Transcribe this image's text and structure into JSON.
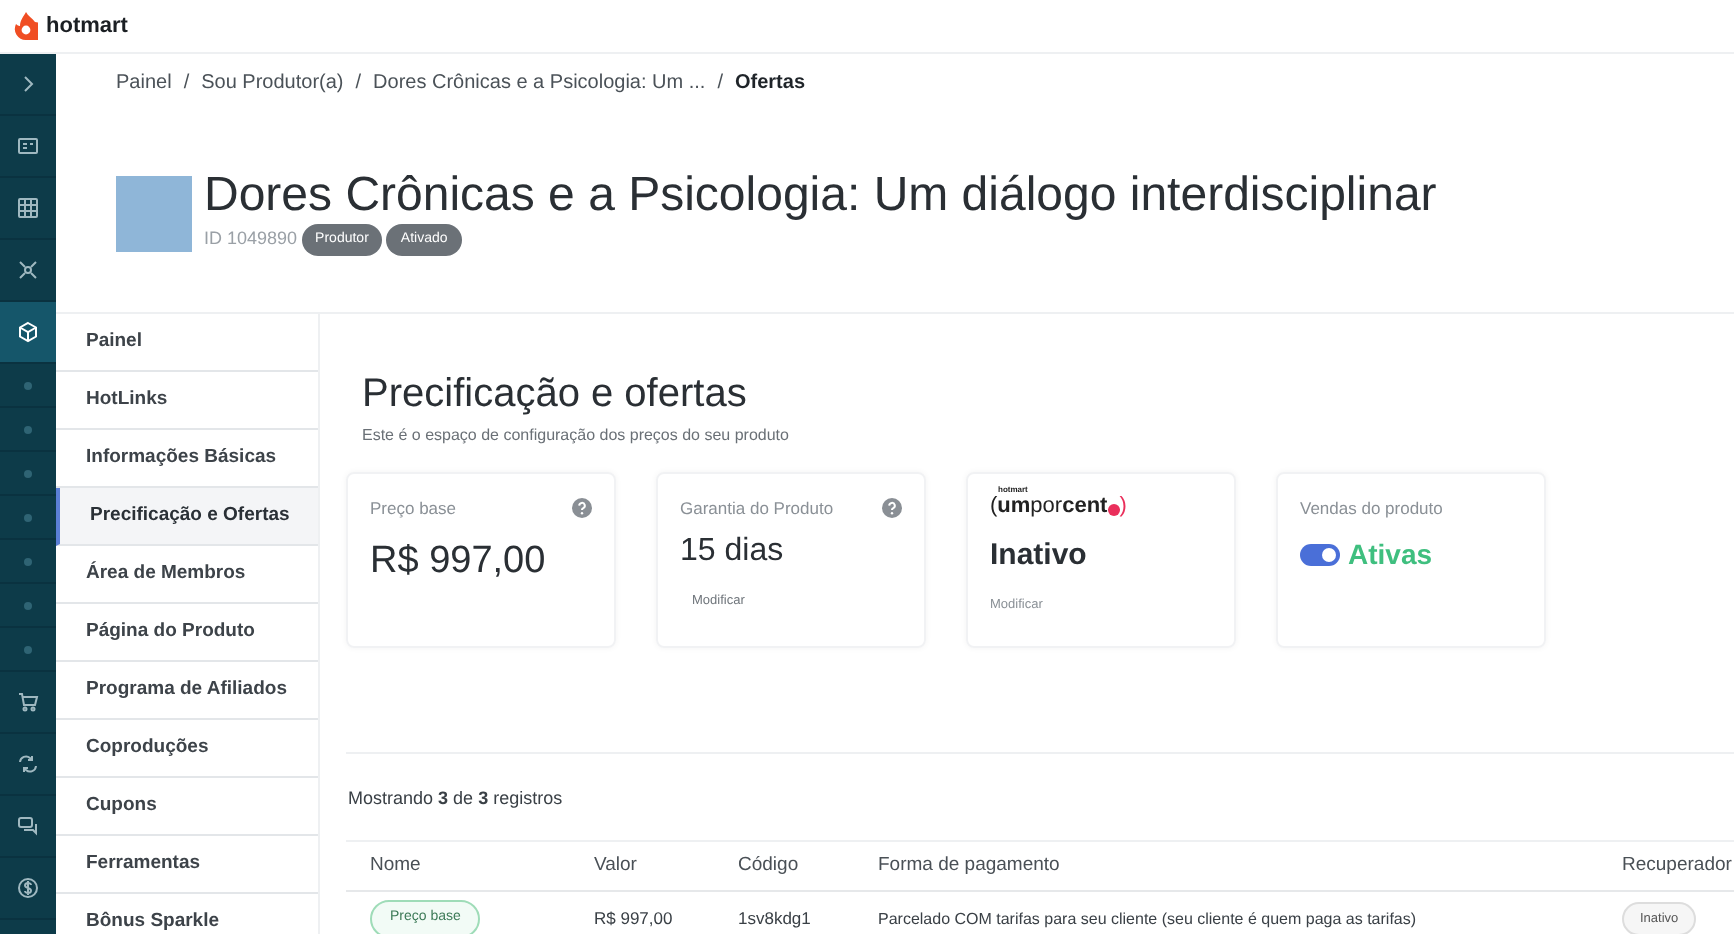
{
  "brand": "hotmart",
  "breadcrumb": [
    "Painel",
    "Sou Produtor(a)",
    "Dores Crônicas e a Psicologia: Um ...",
    "Ofertas"
  ],
  "breadcrumb_separator": "/",
  "product": {
    "title": "Dores Crônicas e a Psicologia: Um diálogo interdisciplinar",
    "id": "ID 1049890",
    "badges": [
      "Produtor",
      "Ativado"
    ]
  },
  "rail": [
    {
      "kind": "chevron",
      "selected": false
    },
    {
      "kind": "card",
      "selected": false
    },
    {
      "kind": "grid",
      "selected": false
    },
    {
      "kind": "network",
      "selected": false
    },
    {
      "kind": "cube",
      "selected": true
    },
    {
      "kind": "dot",
      "selected": false
    },
    {
      "kind": "dot",
      "selected": false
    },
    {
      "kind": "dot",
      "selected": false
    },
    {
      "kind": "dot",
      "selected": false
    },
    {
      "kind": "dot",
      "selected": false
    },
    {
      "kind": "dot",
      "selected": false
    },
    {
      "kind": "dot",
      "selected": false
    },
    {
      "kind": "cart",
      "selected": false
    },
    {
      "kind": "repeat",
      "selected": false
    },
    {
      "kind": "chat",
      "selected": false
    },
    {
      "kind": "dollar",
      "selected": false
    }
  ],
  "nav": [
    {
      "label": "Painel",
      "selected": false
    },
    {
      "label": "HotLinks",
      "selected": false
    },
    {
      "label": "Informações Básicas",
      "selected": false
    },
    {
      "label": "Precificação e Ofertas",
      "selected": true
    },
    {
      "label": "Área de Membros",
      "selected": false
    },
    {
      "label": "Página do Produto",
      "selected": false
    },
    {
      "label": "Programa de Afiliados",
      "selected": false
    },
    {
      "label": "Coproduções",
      "selected": false
    },
    {
      "label": "Cupons",
      "selected": false
    },
    {
      "label": "Ferramentas",
      "selected": false
    },
    {
      "label": "Bônus Sparkle",
      "selected": false
    }
  ],
  "page": {
    "title": "Precificação e ofertas",
    "subtitle": "Este é o espaço de configuração dos preços do seu produto"
  },
  "cards": [
    {
      "kind": "price",
      "label": "Preço base",
      "value": "R$ 997,00"
    },
    {
      "kind": "guarantee",
      "label": "Garantia do Produto",
      "value": "15 dias",
      "link": "Modificar"
    },
    {
      "kind": "logo",
      "logo_small": "hotmart",
      "logo_main": "(**um**por**cent**",
      "logo_end": ")",
      "value": "Inativo",
      "link": "Modificar"
    },
    {
      "kind": "toggle",
      "label": "Vendas do produto",
      "value": "Ativas",
      "on": true
    }
  ],
  "table": {
    "summary": "Mostrando **3** de **3** registros",
    "columns": [
      "Nome",
      "Valor",
      "Código",
      "Forma de pagamento",
      "Recuperador"
    ],
    "rows": [
      {
        "name": "Preço base",
        "valor": "R$ 997,00",
        "codigo": "1sv8kdg1",
        "forma": "Parcelado COM tarifas para seu cliente (seu cliente é quem paga as tarifas)",
        "recuperador": "Inativo"
      }
    ]
  }
}
